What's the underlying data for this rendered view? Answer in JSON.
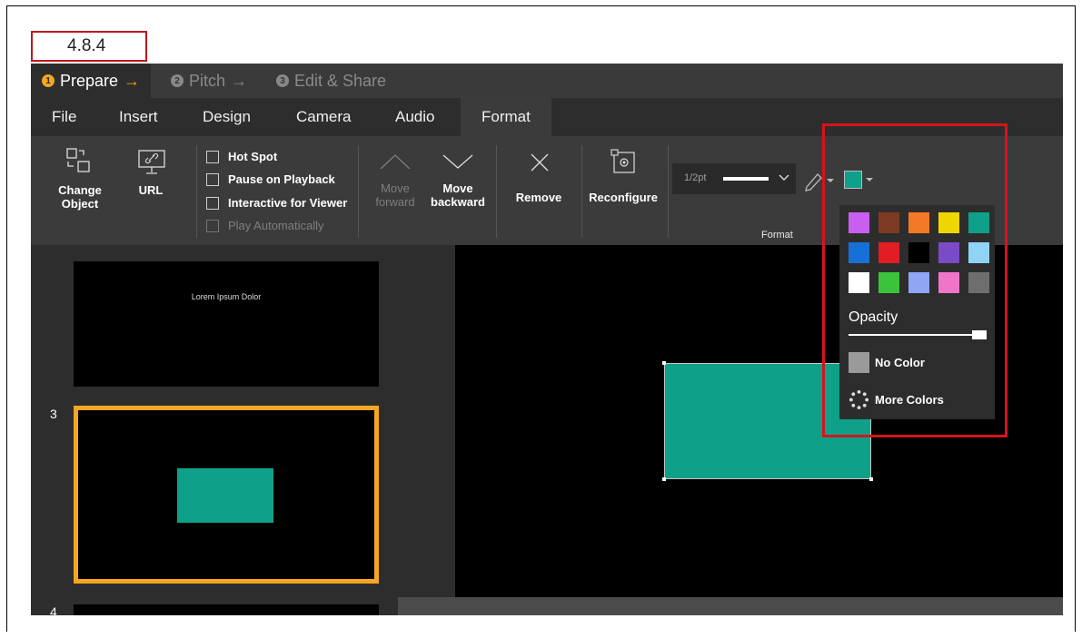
{
  "version_label": "4.8.4",
  "steps": [
    {
      "num": "1",
      "label": "Prepare",
      "arrow": "→"
    },
    {
      "num": "2",
      "label": "Pitch",
      "arrow": "→"
    },
    {
      "num": "3",
      "label": "Edit & Share",
      "arrow": ""
    }
  ],
  "menu": [
    "File",
    "Insert",
    "Design",
    "Camera",
    "Audio",
    "Format"
  ],
  "ribbon": {
    "change_object": "Change Object",
    "url": "URL",
    "checkboxes": [
      "Hot Spot",
      "Pause on Playback",
      "Interactive for Viewer",
      "Play Automatically"
    ],
    "move_forward": [
      "Move",
      "forward"
    ],
    "move_backward": [
      "Move",
      "backward"
    ],
    "remove": "Remove",
    "reconfigure": "Reconfigure",
    "line_weight": "1/2pt",
    "format_label": "Format"
  },
  "slides": {
    "thumb_text": "Lorem Ipsum Dolor",
    "numbers": [
      "3",
      "4"
    ]
  },
  "color_popup": {
    "swatches": [
      "#c85ff0",
      "#7d3a22",
      "#f37a25",
      "#f0d600",
      "#0fa08a",
      "#1770d8",
      "#e01e24",
      "#000000",
      "#7b4bc7",
      "#8fd3f5",
      "#ffffff",
      "#3cc33c",
      "#8fa6f5",
      "#f075c8",
      "#6e6e6e"
    ],
    "opacity_label": "Opacity",
    "opacity": 1.0,
    "no_color": "No Color",
    "more_colors": "More Colors"
  },
  "colors": {
    "accent": "#f5a623",
    "selection_highlight": "#d4151c",
    "current_fill": "#0fa08a"
  }
}
